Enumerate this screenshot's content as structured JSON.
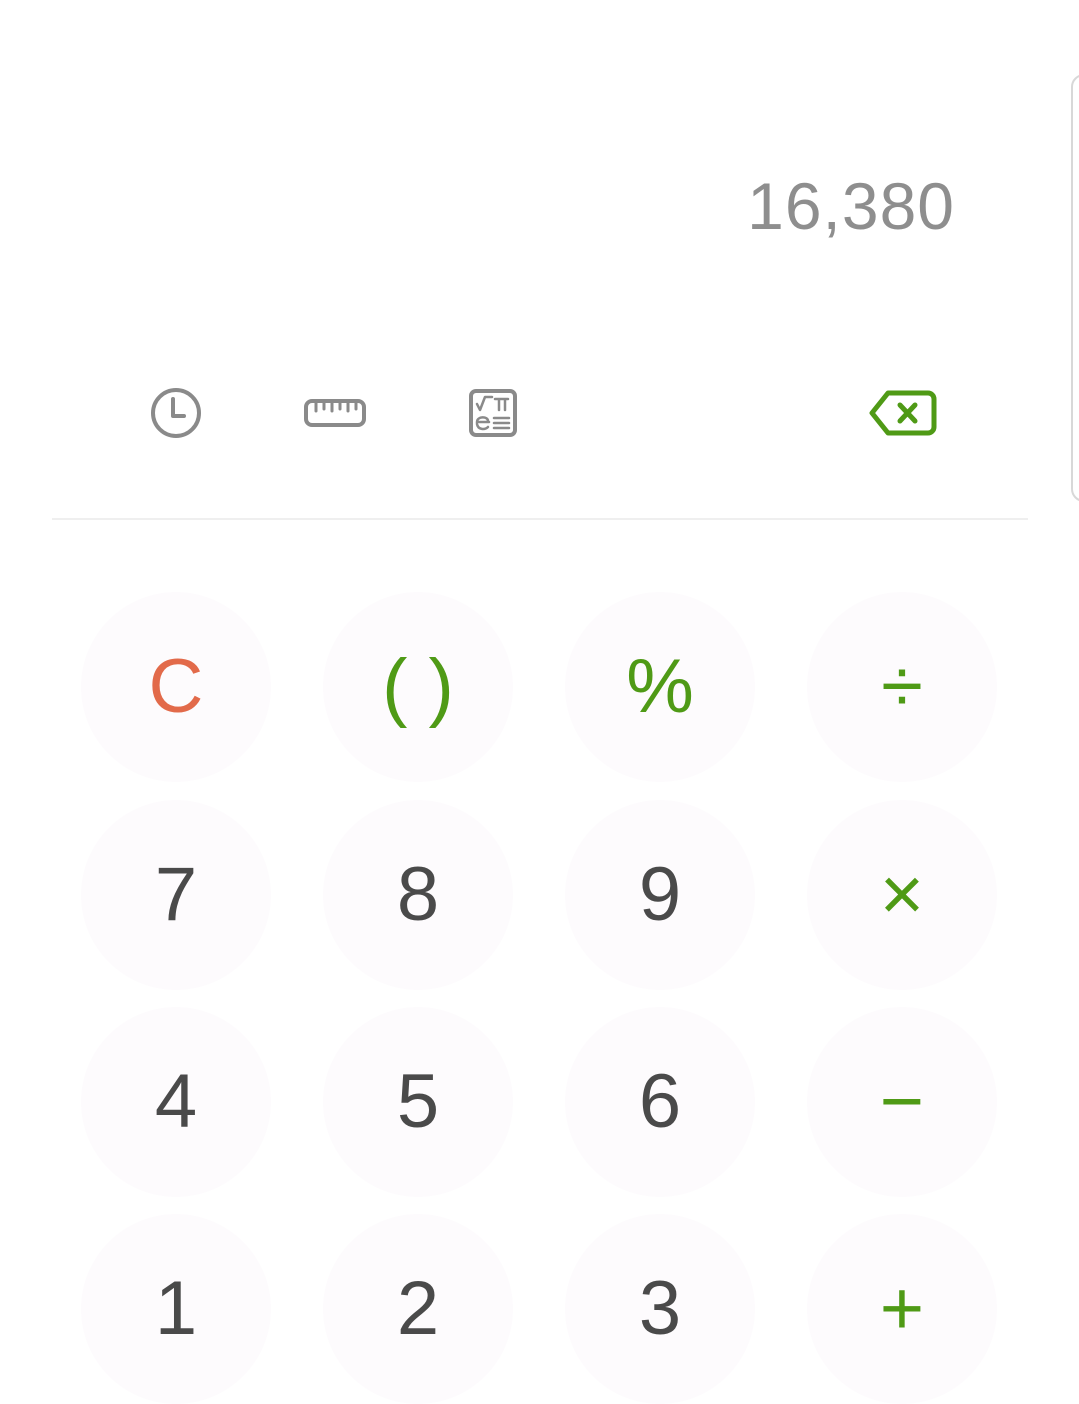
{
  "display": {
    "result": "16,380"
  },
  "toolbar": {
    "history_icon": "clock-icon",
    "converter_icon": "ruler-icon",
    "scientific_icon": "scientific-functions-icon",
    "backspace_icon": "backspace-icon"
  },
  "colors": {
    "operator": "#4f9a16",
    "clear": "#e26a4a",
    "digit": "#4a4a4a",
    "result": "#8e8e8e",
    "toolbar_icon": "#8a8a8a"
  },
  "keys": {
    "clear": "C",
    "parentheses": "( )",
    "percent": "%",
    "divide": "÷",
    "seven": "7",
    "eight": "8",
    "nine": "9",
    "multiply": "×",
    "four": "4",
    "five": "5",
    "six": "6",
    "minus": "−",
    "one": "1",
    "two": "2",
    "three": "3",
    "plus": "+"
  }
}
